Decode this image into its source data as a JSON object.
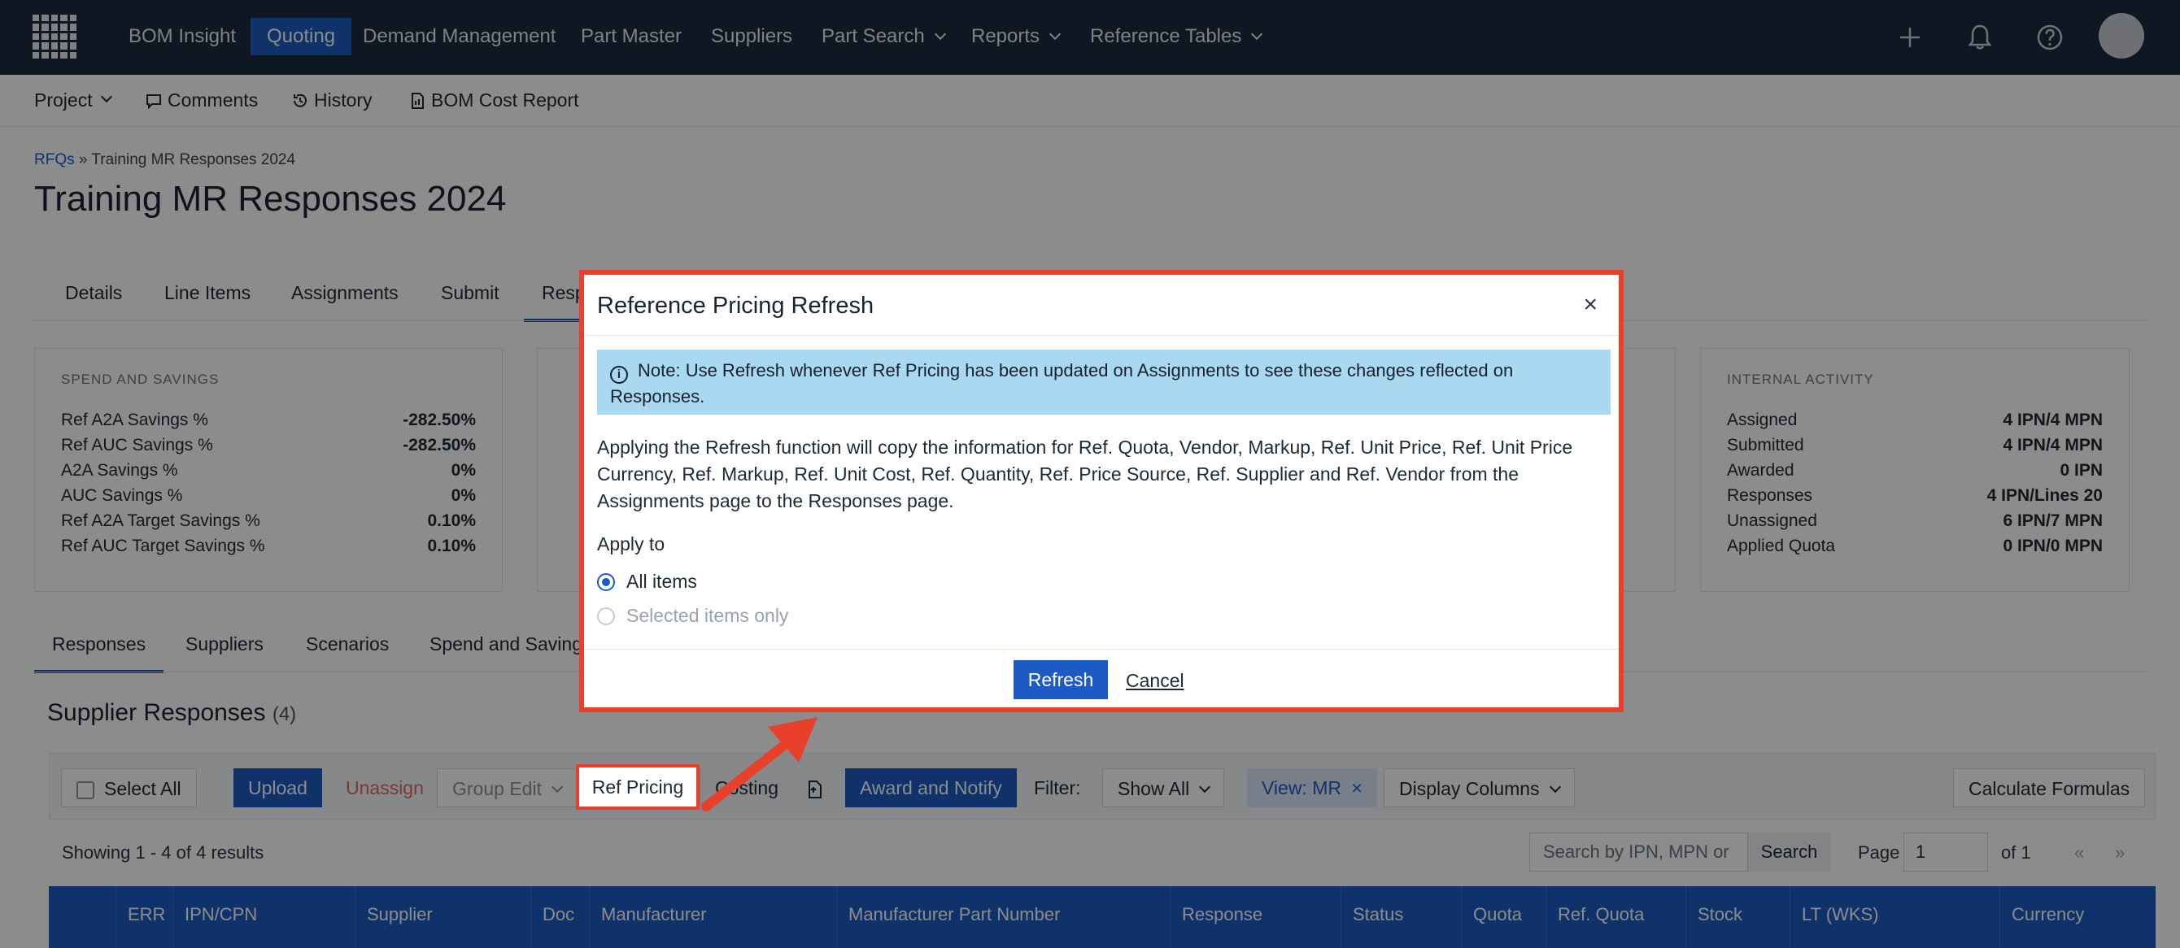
{
  "nav": {
    "items": [
      {
        "label": "BOM Insight",
        "active": false,
        "dropdown": false
      },
      {
        "label": "Quoting",
        "active": true,
        "dropdown": false
      },
      {
        "label": "Demand Management",
        "active": false,
        "dropdown": false
      },
      {
        "label": "Part Master",
        "active": false,
        "dropdown": false
      },
      {
        "label": "Suppliers",
        "active": false,
        "dropdown": false
      },
      {
        "label": "Part Search",
        "active": false,
        "dropdown": true
      },
      {
        "label": "Reports",
        "active": false,
        "dropdown": true
      },
      {
        "label": "Reference Tables",
        "active": false,
        "dropdown": true
      }
    ],
    "icons": [
      "plus-icon",
      "bell-icon",
      "help-icon"
    ]
  },
  "subbar": {
    "project": "Project",
    "comments": "Comments",
    "history": "History",
    "bom_cost_report": "BOM Cost Report"
  },
  "breadcrumb": {
    "root": "RFQs",
    "separator": "»",
    "current": "Training MR Responses 2024"
  },
  "page_title": "Training MR Responses 2024",
  "tabs_top": [
    "Details",
    "Line Items",
    "Assignments",
    "Submit",
    "Resp"
  ],
  "spend_card": {
    "title": "SPEND AND SAVINGS",
    "rows": [
      {
        "k": "Ref A2A Savings %",
        "v": "-282.50%"
      },
      {
        "k": "Ref AUC Savings %",
        "v": "-282.50%"
      },
      {
        "k": "A2A Savings %",
        "v": "0%"
      },
      {
        "k": "AUC Savings %",
        "v": "0%"
      },
      {
        "k": "Ref A2A Target Savings %",
        "v": "0.10%"
      },
      {
        "k": "Ref AUC Target Savings %",
        "v": "0.10%"
      }
    ]
  },
  "activity_card": {
    "title": "INTERNAL ACTIVITY",
    "rows": [
      {
        "k": "Assigned",
        "v": "4 IPN/4 MPN"
      },
      {
        "k": "Submitted",
        "v": "4 IPN/4 MPN"
      },
      {
        "k": "Awarded",
        "v": "0 IPN"
      },
      {
        "k": "Responses",
        "v": "4 IPN/Lines 20"
      },
      {
        "k": "Unassigned",
        "v": "6 IPN/7 MPN"
      },
      {
        "k": "Applied Quota",
        "v": "0 IPN/0 MPN"
      }
    ]
  },
  "tabs_bottom": [
    "Responses",
    "Suppliers",
    "Scenarios",
    "Spend and Saving"
  ],
  "section": {
    "title": "Supplier Responses",
    "count": "(4)"
  },
  "toolbar": {
    "select_all": "Select All",
    "upload": "Upload",
    "unassign": "Unassign",
    "group_edit": "Group Edit",
    "ref_pricing": "Ref Pricing",
    "costing": "Costing",
    "award_notify": "Award and Notify",
    "filter_label": "Filter:",
    "filter_value": "Show All",
    "view_chip": "View: MR",
    "display_columns": "Display Columns",
    "calculate": "Calculate Formulas"
  },
  "results": {
    "showing": "Showing 1 - 4 of 4 results",
    "search_placeholder": "Search by IPN, MPN or",
    "search_button": "Search",
    "page_label": "Page",
    "page_value": "1",
    "page_of": "of 1",
    "prev": "«",
    "next": "»"
  },
  "table_headers": [
    "ERR",
    "IPN/CPN",
    "Supplier",
    "Doc",
    "Manufacturer",
    "Manufacturer Part Number",
    "Response",
    "Status",
    "Quota",
    "Ref. Quota",
    "Stock",
    "LT (WKS)",
    "Currency"
  ],
  "modal": {
    "title": "Reference Pricing Refresh",
    "close": "×",
    "note": "Note: Use Refresh whenever Ref Pricing has been updated on Assignments to see these changes reflected on Responses.",
    "description": "Applying the Refresh function will copy the information for Ref. Quota, Vendor, Markup, Ref. Unit Price, Ref. Unit Price Currency, Ref. Markup, Ref. Unit Cost, Ref. Quantity, Ref. Price Source, Ref. Supplier and Ref. Vendor from the Assignments page to the Responses page.",
    "apply_label": "Apply to",
    "option_all": "All items",
    "option_selected": "Selected items only",
    "refresh": "Refresh",
    "cancel": "Cancel"
  },
  "colors": {
    "nav_bg": "#1b2a3f",
    "accent": "#1d5bc4",
    "highlight": "#e8402a",
    "note_bg": "#a9d8f0"
  }
}
